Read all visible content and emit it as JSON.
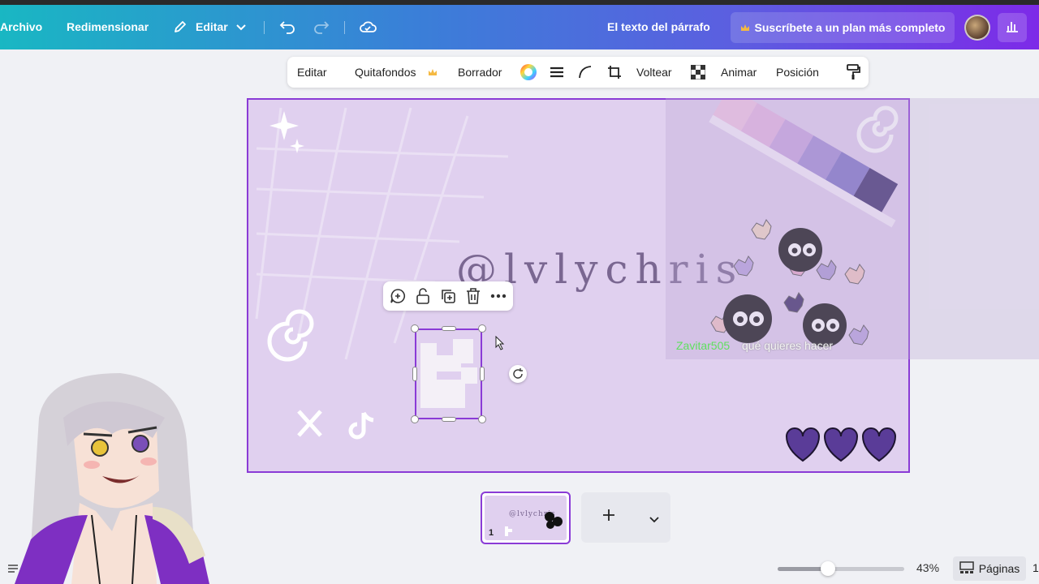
{
  "topbar": {
    "file": "Archivo",
    "resize": "Redimensionar",
    "edit": "Editar",
    "doc_title": "El texto del párrafo",
    "plan_button": "Suscríbete a un plan más completo"
  },
  "toolbar": {
    "edit": "Editar",
    "bg_remover": "Quitafondos",
    "eraser": "Borrador",
    "flip": "Voltear",
    "animate": "Animar",
    "position": "Posición"
  },
  "canvas": {
    "handle": "@lvlychris",
    "chat_user": "Zavitar505",
    "chat_message": "qué quieres hacer",
    "hearts_count": 3
  },
  "pages": {
    "thumb_number": "1",
    "thumb_handle": "@lvlychris",
    "add_symbol": "+"
  },
  "footer": {
    "zoom_value": 0.43,
    "zoom_label": "43%",
    "pages_button": "Páginas",
    "edge_number": "1"
  },
  "colors": {
    "accent": "#8a3bd6",
    "canvas_bg": "#e0d0ef",
    "chat_user": "#5fe05f"
  },
  "icons": [
    "pencil-icon",
    "chevron-down-icon",
    "undo-icon",
    "redo-icon",
    "cloud-saved-icon",
    "crown-icon",
    "bar-chart-icon",
    "color-wheel-icon",
    "lines-icon",
    "curve-icon",
    "crop-icon",
    "transparency-icon",
    "paint-roller-icon",
    "comment-add-icon",
    "unlock-icon",
    "duplicate-icon",
    "trash-icon",
    "more-icon",
    "rotate-icon",
    "plus-icon",
    "pages-grid-icon"
  ]
}
